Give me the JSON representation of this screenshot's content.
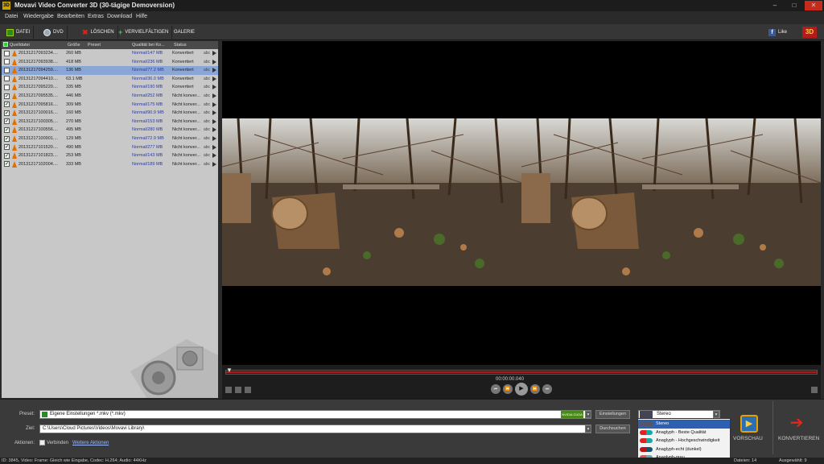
{
  "window": {
    "title": "Movavi Video Converter 3D (30-tägige Demoversion)",
    "logo_text": "3D"
  },
  "menu": [
    "Datei",
    "Wiedergabe",
    "Bearbeiten",
    "Extras",
    "Download",
    "Hilfe"
  ],
  "toolbar": {
    "buttons": [
      "DATEI",
      "DVD",
      "LÖSCHEN",
      "VERVIELFÄLTIGEN",
      "GALERIE"
    ],
    "like": "Like",
    "badge": "3D"
  },
  "table": {
    "headers": [
      "Quelldatei",
      "Größe",
      "Preset",
      "Qualität bei Ko...",
      "Status"
    ],
    "rows": [
      {
        "name": "20131217093234....",
        "size": "260 MB",
        "quality": "Normal/147 MB",
        "status": "Konvertiert",
        "checked": false
      },
      {
        "name": "20131217093938....",
        "size": "418 MB",
        "quality": "Normal/236 MB",
        "status": "Konvertiert",
        "checked": false
      },
      {
        "name": "20131217094259....",
        "size": "136 MB",
        "quality": "Normal/77.2 MB",
        "status": "Konvertiert",
        "checked": false
      },
      {
        "name": "20131217094410....",
        "size": "63.1 MB",
        "quality": "Normal/36.0 MB",
        "status": "Konvertiert",
        "checked": false
      },
      {
        "name": "20131217095220....",
        "size": "335 MB",
        "quality": "Normal/190 MB",
        "status": "Konvertiert",
        "checked": false
      },
      {
        "name": "20131217095535....",
        "size": "446 MB",
        "quality": "Normal/252 MB",
        "status": "Nicht konver...",
        "checked": true
      },
      {
        "name": "20131217095816....",
        "size": "309 MB",
        "quality": "Normal/175 MB",
        "status": "Nicht konver...",
        "checked": true
      },
      {
        "name": "20131217100016....",
        "size": "160 MB",
        "quality": "Normal/90.9 MB",
        "status": "Nicht konver...",
        "checked": true
      },
      {
        "name": "20131217100305....",
        "size": "270 MB",
        "quality": "Normal/153 MB",
        "status": "Nicht konver...",
        "checked": true
      },
      {
        "name": "20131217100556....",
        "size": "495 MB",
        "quality": "Normal/280 MB",
        "status": "Nicht konver...",
        "checked": true
      },
      {
        "name": "20131217100901....",
        "size": "129 MB",
        "quality": "Normal/72.9 MB",
        "status": "Nicht konver...",
        "checked": true
      },
      {
        "name": "20131217101520....",
        "size": "490 MB",
        "quality": "Normal/277 MB",
        "status": "Nicht konver...",
        "checked": true
      },
      {
        "name": "20131217101823....",
        "size": "253 MB",
        "quality": "Normal/143 MB",
        "status": "Nicht konver...",
        "checked": true
      },
      {
        "name": "20131217102004....",
        "size": "333 MB",
        "quality": "Normal/189 MB",
        "status": "Nicht konver...",
        "checked": true
      }
    ],
    "selected_index": 2,
    "row_suffix": "abc"
  },
  "player": {
    "timecode": "00:00:00.040",
    "progress": 1.0
  },
  "bottom": {
    "preset_label": "Preset:",
    "preset_value": "Eigene Einstellungen *.mkv (*.mkv)",
    "cuda_badge": "NVIDIA CUDA",
    "settings_button": "Einstellungen",
    "target_label": "Ziel:",
    "target_value": "C:\\Users\\Cloud Pictures\\Videos\\Movavi Library\\",
    "browse_button": "Durchsuchen",
    "actions_label": "Aktionen:",
    "join_label": "Verbinden",
    "more_actions": "Weitere Aktionen",
    "mode_value": "Stereo",
    "preview_button": "VORSCHAU",
    "convert_button": "KONVERTIEREN"
  },
  "dropdown": {
    "options": [
      "Stereo",
      "Anaglyph - Beste Qualität",
      "Anaglyph - Hochgeschwindigkeit",
      "Anaglyph-echt (dunkel)",
      "Anaglyph-grau"
    ],
    "selected_index": 0
  },
  "status": {
    "left": "ID: 3845, Video: Frame: Gleich wie Eingabe, Codec: H.264; Audio: 44KHz",
    "files": "Dateien: 14",
    "selected": "Ausgewählt: 9"
  },
  "colors": {
    "selected_row": "#8aa6d6",
    "track": "#b21818",
    "accent_blue": "#2d5fb3"
  }
}
